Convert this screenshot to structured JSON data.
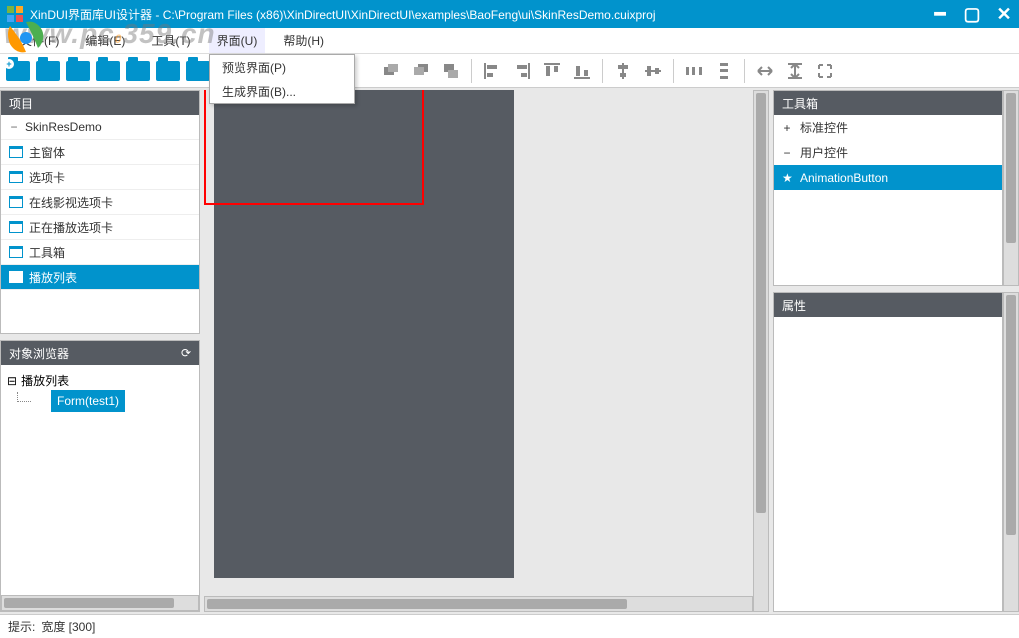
{
  "titlebar": {
    "app_prefix": "XinDUI界面库UI设计器 - ",
    "path": "C:\\Program Files (x86)\\XinDirectUI\\XinDirectUI\\examples\\BaoFeng\\ui\\SkinResDemo.cuixproj"
  },
  "watermark": "www.pc0359.cn",
  "menubar": {
    "file": "文件(F)",
    "edit": "编辑(E)",
    "tools": "工具(T)",
    "ui": "界面(U)",
    "help": "帮助(H)"
  },
  "dropdown": {
    "preview": "预览界面(P)",
    "generate": "生成界面(B)..."
  },
  "project": {
    "title": "项目",
    "items": [
      {
        "exp": "−",
        "label": "SkinResDemo",
        "is_folder": false
      },
      {
        "exp": "",
        "label": "主窗体",
        "is_folder": true
      },
      {
        "exp": "",
        "label": "选项卡",
        "is_folder": true
      },
      {
        "exp": "",
        "label": "在线影视选项卡",
        "is_folder": true
      },
      {
        "exp": "",
        "label": "正在播放选项卡",
        "is_folder": true
      },
      {
        "exp": "",
        "label": "工具箱",
        "is_folder": true
      },
      {
        "exp": "",
        "label": "播放列表",
        "is_folder": true,
        "selected": true
      }
    ]
  },
  "browser": {
    "title": "对象浏览器",
    "root_exp": "⊟",
    "root": "播放列表",
    "child": "Form(test1)"
  },
  "toolbox": {
    "title": "工具箱",
    "rows": [
      {
        "pm": "+",
        "label": "标准控件"
      },
      {
        "pm": "−",
        "label": "用户控件"
      },
      {
        "pm": "★",
        "label": "AnimationButton",
        "selected": true
      }
    ]
  },
  "properties": {
    "title": "属性"
  },
  "statusbar": {
    "hint": "提示:",
    "width": "宽度 [300]"
  }
}
